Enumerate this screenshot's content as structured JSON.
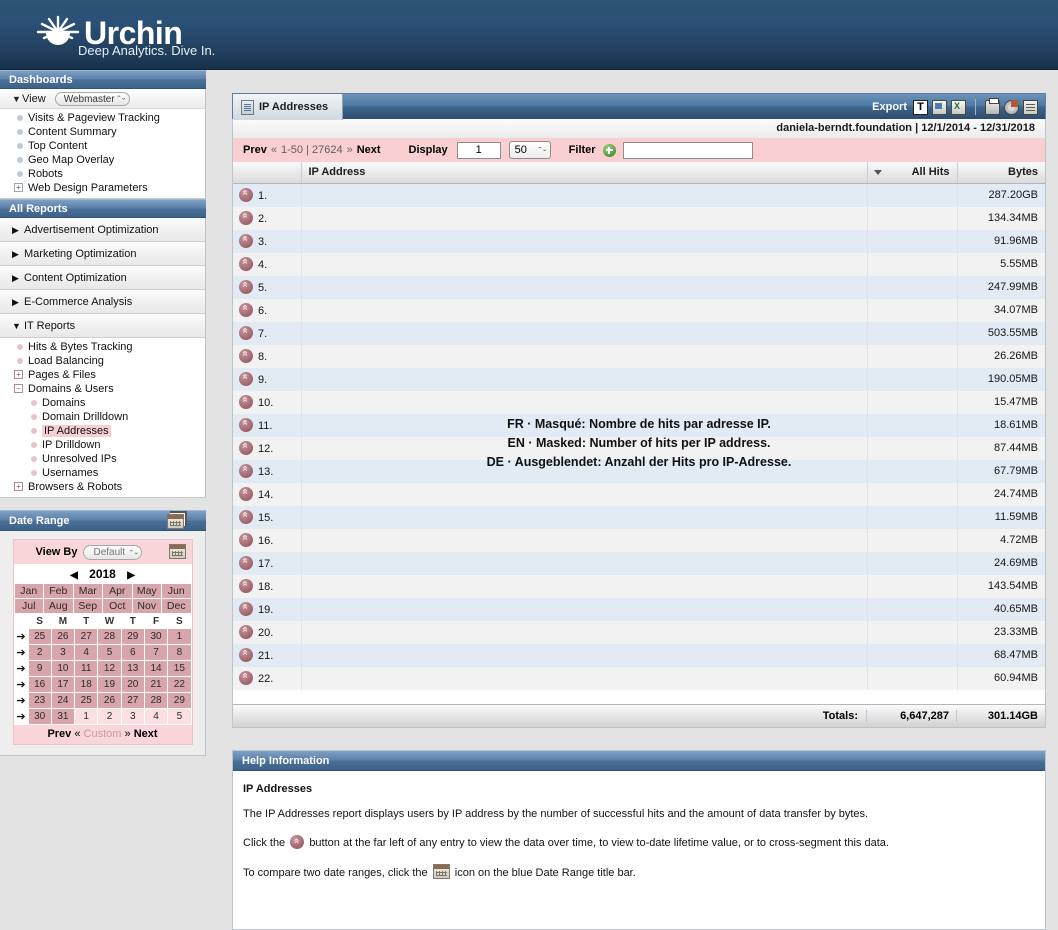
{
  "brand": {
    "name": "Urchin",
    "tagline": "Deep Analytics. Dive In.",
    "logo_icon": "sunburst-icon"
  },
  "sidebar": {
    "dashboards": {
      "title": "Dashboards",
      "view_label": "View",
      "view_selected": "Webmaster",
      "items": [
        {
          "label": "Visits & Pageview Tracking",
          "type": "leaf"
        },
        {
          "label": "Content Summary",
          "type": "leaf"
        },
        {
          "label": "Top Content",
          "type": "leaf"
        },
        {
          "label": "Geo Map Overlay",
          "type": "leaf"
        },
        {
          "label": "Robots",
          "type": "leaf"
        },
        {
          "label": "Web Design Parameters",
          "type": "expand",
          "glyph": "+"
        }
      ]
    },
    "all_reports": {
      "title": "All Reports",
      "sections": [
        {
          "label": "Advertisement Optimization",
          "glyph": "▶",
          "open": false
        },
        {
          "label": "Marketing Optimization",
          "glyph": "▶",
          "open": false
        },
        {
          "label": "Content Optimization",
          "glyph": "▶",
          "open": false
        },
        {
          "label": "E-Commerce Analysis",
          "glyph": "▶",
          "open": false
        },
        {
          "label": "IT Reports",
          "glyph": "▼",
          "open": true
        }
      ],
      "it_reports_items": [
        {
          "label": "Hits & Bytes Tracking",
          "type": "leaf",
          "level": 1
        },
        {
          "label": "Load Balancing",
          "type": "leaf",
          "level": 1
        },
        {
          "label": "Pages & Files",
          "type": "expand",
          "glyph": "+",
          "level": 1
        },
        {
          "label": "Domains & Users",
          "type": "expand",
          "glyph": "–",
          "level": 1
        },
        {
          "label": "Domains",
          "type": "leaf",
          "level": 2
        },
        {
          "label": "Domain Drilldown",
          "type": "leaf",
          "level": 2
        },
        {
          "label": "IP Addresses",
          "type": "leaf",
          "level": 2,
          "selected": true
        },
        {
          "label": "IP Drilldown",
          "type": "leaf",
          "level": 2
        },
        {
          "label": "Unresolved IPs",
          "type": "leaf",
          "level": 2
        },
        {
          "label": "Usernames",
          "type": "leaf",
          "level": 2
        },
        {
          "label": "Browsers & Robots",
          "type": "expand",
          "glyph": "+",
          "level": 1
        }
      ]
    },
    "date_range": {
      "title": "Date Range",
      "compare_icon": "calendar-compare-icon",
      "view_by_label": "View By",
      "view_by_value": "Default",
      "calendar_icon": "calendar-icon",
      "year": "2018",
      "prev_year_glyph": "◀",
      "next_year_glyph": "▶",
      "months": [
        "Jan",
        "Feb",
        "Mar",
        "Apr",
        "May",
        "Jun",
        "Jul",
        "Aug",
        "Sep",
        "Oct",
        "Nov",
        "Dec"
      ],
      "weekday_headers": [
        "S",
        "M",
        "T",
        "W",
        "T",
        "F",
        "S"
      ],
      "weeks": [
        {
          "arrow": "➔",
          "days": [
            {
              "d": "25",
              "on": true
            },
            {
              "d": "26",
              "on": true
            },
            {
              "d": "27",
              "on": true
            },
            {
              "d": "28",
              "on": true
            },
            {
              "d": "29",
              "on": true
            },
            {
              "d": "30",
              "on": true
            },
            {
              "d": "1",
              "on": true
            }
          ]
        },
        {
          "arrow": "➔",
          "days": [
            {
              "d": "2",
              "on": true
            },
            {
              "d": "3",
              "on": true
            },
            {
              "d": "4",
              "on": true
            },
            {
              "d": "5",
              "on": true
            },
            {
              "d": "6",
              "on": true
            },
            {
              "d": "7",
              "on": true
            },
            {
              "d": "8",
              "on": true
            }
          ]
        },
        {
          "arrow": "➔",
          "days": [
            {
              "d": "9",
              "on": true
            },
            {
              "d": "10",
              "on": true
            },
            {
              "d": "11",
              "on": true
            },
            {
              "d": "12",
              "on": true
            },
            {
              "d": "13",
              "on": true
            },
            {
              "d": "14",
              "on": true
            },
            {
              "d": "15",
              "on": true
            }
          ]
        },
        {
          "arrow": "➔",
          "days": [
            {
              "d": "16",
              "on": true
            },
            {
              "d": "17",
              "on": true
            },
            {
              "d": "18",
              "on": true
            },
            {
              "d": "19",
              "on": true
            },
            {
              "d": "20",
              "on": true
            },
            {
              "d": "21",
              "on": true
            },
            {
              "d": "22",
              "on": true
            }
          ]
        },
        {
          "arrow": "➔",
          "days": [
            {
              "d": "23",
              "on": true
            },
            {
              "d": "24",
              "on": true
            },
            {
              "d": "25",
              "on": true
            },
            {
              "d": "26",
              "on": true
            },
            {
              "d": "27",
              "on": true
            },
            {
              "d": "28",
              "on": true
            },
            {
              "d": "29",
              "on": true
            }
          ]
        },
        {
          "arrow": "➔",
          "days": [
            {
              "d": "30",
              "on": true
            },
            {
              "d": "31",
              "on": true
            },
            {
              "d": "1",
              "on": false
            },
            {
              "d": "2",
              "on": false
            },
            {
              "d": "3",
              "on": false
            },
            {
              "d": "4",
              "on": false
            },
            {
              "d": "5",
              "on": false
            }
          ]
        }
      ],
      "footer": {
        "prev": "Prev",
        "prev_chev": "«",
        "custom": "Custom",
        "next_chev": "»",
        "next": "Next"
      }
    }
  },
  "report": {
    "tab": {
      "label": "IP Addresses",
      "icon": "report-doc-icon"
    },
    "export": {
      "label": "Export",
      "icons": [
        "export-text-icon",
        "export-image-icon",
        "export-excel-icon"
      ],
      "tools": [
        "print-icon",
        "pie-chart-add-icon",
        "report-schedule-icon"
      ]
    },
    "profile": "daniela-berndt.foundation",
    "separator": "|",
    "date_range_text": "12/1/2014 - 12/31/2018",
    "toolbar": {
      "prev": "Prev",
      "prev_chev": "«",
      "range": "1-50 | 27624",
      "next_chev": "»",
      "next": "Next",
      "display_label": "Display",
      "display_value": "1",
      "rows_value": "50",
      "filter_label": "Filter",
      "filter_add_icon": "add-filter-icon",
      "filter_value": "",
      "filter_placeholder": ""
    },
    "columns": {
      "num": "",
      "ip_address": "IP Address",
      "all_hits": "All Hits",
      "bytes": "Bytes"
    },
    "sort_indicator": "sort-desc-icon",
    "masked_notice": [
      "FR · Masqué: Nombre de hits par adresse IP.",
      "EN · Masked: Number of hits per IP address.",
      "DE · Ausgeblendet: Anzahl der Hits pro IP-Adresse."
    ],
    "rows": [
      {
        "n": "1.",
        "ip": "",
        "hits": "",
        "bytes": "287.20GB"
      },
      {
        "n": "2.",
        "ip": "",
        "hits": "",
        "bytes": "134.34MB"
      },
      {
        "n": "3.",
        "ip": "",
        "hits": "",
        "bytes": "91.96MB"
      },
      {
        "n": "4.",
        "ip": "",
        "hits": "",
        "bytes": "5.55MB"
      },
      {
        "n": "5.",
        "ip": "",
        "hits": "",
        "bytes": "247.99MB"
      },
      {
        "n": "6.",
        "ip": "",
        "hits": "",
        "bytes": "34.07MB"
      },
      {
        "n": "7.",
        "ip": "",
        "hits": "",
        "bytes": "503.55MB"
      },
      {
        "n": "8.",
        "ip": "",
        "hits": "",
        "bytes": "26.26MB"
      },
      {
        "n": "9.",
        "ip": "",
        "hits": "",
        "bytes": "190.05MB"
      },
      {
        "n": "10.",
        "ip": "",
        "hits": "",
        "bytes": "15.47MB"
      },
      {
        "n": "11.",
        "ip": "",
        "hits": "",
        "bytes": "18.61MB"
      },
      {
        "n": "12.",
        "ip": "",
        "hits": "",
        "bytes": "87.44MB"
      },
      {
        "n": "13.",
        "ip": "",
        "hits": "",
        "bytes": "67.79MB"
      },
      {
        "n": "14.",
        "ip": "",
        "hits": "",
        "bytes": "24.74MB"
      },
      {
        "n": "15.",
        "ip": "",
        "hits": "",
        "bytes": "11.59MB"
      },
      {
        "n": "16.",
        "ip": "",
        "hits": "",
        "bytes": "4.72MB"
      },
      {
        "n": "17.",
        "ip": "",
        "hits": "",
        "bytes": "24.69MB"
      },
      {
        "n": "18.",
        "ip": "",
        "hits": "",
        "bytes": "143.54MB"
      },
      {
        "n": "19.",
        "ip": "",
        "hits": "",
        "bytes": "40.65MB"
      },
      {
        "n": "20.",
        "ip": "",
        "hits": "",
        "bytes": "23.33MB"
      },
      {
        "n": "21.",
        "ip": "",
        "hits": "",
        "bytes": "68.47MB"
      },
      {
        "n": "22.",
        "ip": "",
        "hits": "",
        "bytes": "60.94MB"
      }
    ],
    "totals": {
      "label": "Totals:",
      "all_hits": "6,647,287",
      "bytes": "301.14GB"
    }
  },
  "help": {
    "title": "Help Information",
    "heading": "IP Addresses",
    "p1": "The IP Addresses report displays users by IP address by the number of successful hits and the amount of data transfer by bytes.",
    "p2_a": "Click the",
    "p2_b": "button at the far left of any entry to view the data over time, to view to-date lifetime value, or to cross-segment this data.",
    "p3_a": "To compare two date ranges, click the",
    "p3_b": "icon on the blue Date Range title bar."
  },
  "colors": {
    "banner": "#2a5075",
    "panel_bar": "#4b7099",
    "pink_toolbar": "#f9cfd2",
    "row_odd": "#e2eaf3",
    "row_even": "#f2f2f2",
    "selected_nav": "#f6ced4",
    "calendar_selected": "#d8a5ab"
  }
}
